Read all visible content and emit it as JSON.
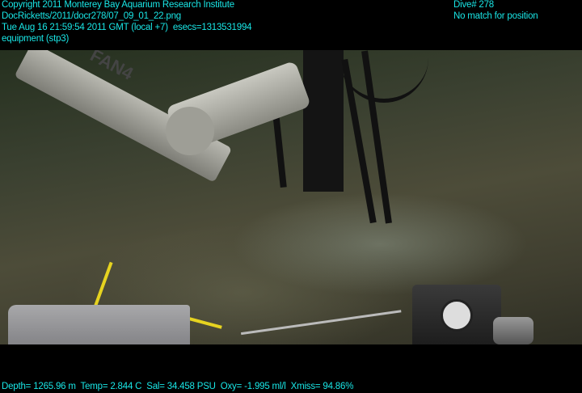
{
  "header": {
    "copyright": "Copyright 2011 Monterey Bay Aquarium Research Institute",
    "file_path": "DocRicketts/2011/docr278/07_09_01_22.png",
    "timestamp": "Tue Aug 16 21:59:54 2011 GMT (local +7)  esecs=1313531994",
    "category": "equipment (stp3)",
    "dive": "Dive# 278",
    "position_status": "No match for position"
  },
  "footer": {
    "telemetry": "Depth= 1265.96 m  Temp= 2.844 C  Sal= 34.458 PSU  Oxy= -1.995 ml/l  Xmiss= 94.86%"
  },
  "scene": {
    "arm_label": "FAN4"
  }
}
